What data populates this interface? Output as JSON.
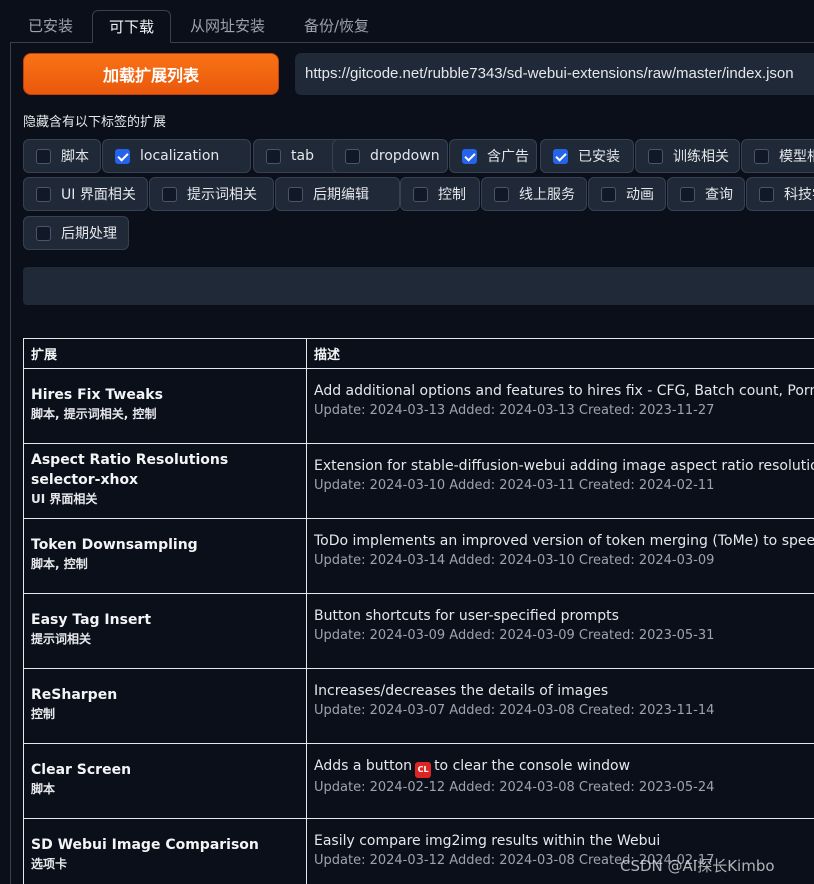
{
  "tabs": [
    {
      "label": "已安装"
    },
    {
      "label": "可下载"
    },
    {
      "label": "从网址安装"
    },
    {
      "label": "备份/恢复"
    }
  ],
  "load_button_label": "加载扩展列表",
  "url_value": "https://gitcode.net/rubble7343/sd-webui-extensions/raw/master/index.json",
  "hide_label": "隐藏含有以下标签的扩展",
  "tags": [
    {
      "label": "脚本",
      "checked": false
    },
    {
      "label": "localization",
      "checked": true
    },
    {
      "label": "tab",
      "checked": false
    },
    {
      "label": "dropdown",
      "checked": false
    },
    {
      "label": "含广告",
      "checked": true
    },
    {
      "label": "已安装",
      "checked": true
    },
    {
      "label": "训练相关",
      "checked": false
    },
    {
      "label": "模型相关",
      "checked": false
    },
    {
      "label": "UI 界面相关",
      "checked": false
    },
    {
      "label": "提示词相关",
      "checked": false
    },
    {
      "label": "后期编辑",
      "checked": false
    },
    {
      "label": "控制",
      "checked": false
    },
    {
      "label": "线上服务",
      "checked": false
    },
    {
      "label": "动画",
      "checked": false
    },
    {
      "label": "查询",
      "checked": false
    },
    {
      "label": "科技学术",
      "checked": false
    },
    {
      "label": "后期处理",
      "checked": false
    }
  ],
  "table": {
    "headers": [
      "扩展",
      "描述"
    ],
    "rows": [
      {
        "name": "Hires Fix Tweaks",
        "tags": "脚本, 提示词相关, 控制",
        "desc": "Add additional options and features to hires fix - CFG, Batch count, Pormpt",
        "dates": "Update: 2024-03-13 Added: 2024-03-13 Created: 2023-11-27"
      },
      {
        "name": "Aspect Ratio Resolutions selector-xhox",
        "tags": "UI 界面相关",
        "desc": "Extension for stable-diffusion-webui adding image aspect ratio resolutions",
        "dates": "Update: 2024-03-10 Added: 2024-03-11 Created: 2024-02-11"
      },
      {
        "name": "Token Downsampling",
        "tags": "脚本, 控制",
        "desc": "ToDo implements an improved version of token merging (ToMe) to speed u",
        "dates": "Update: 2024-03-14 Added: 2024-03-10 Created: 2024-03-09"
      },
      {
        "name": "Easy Tag Insert",
        "tags": "提示词相关",
        "desc": "Button shortcuts for user-specified prompts",
        "dates": "Update: 2024-03-09 Added: 2024-03-09 Created: 2023-05-31"
      },
      {
        "name": "ReSharpen",
        "tags": "控制",
        "desc": "Increases/decreases the details of images",
        "dates": "Update: 2024-03-07 Added: 2024-03-08 Created: 2023-11-14"
      },
      {
        "name": "Clear Screen",
        "tags": "脚本",
        "desc_before": "Adds a button",
        "desc_icon": "CL",
        "desc_after": "to clear the console window",
        "dates": "Update: 2024-02-12 Added: 2024-03-08 Created: 2023-05-24"
      },
      {
        "name": "SD Webui Image Comparison",
        "tags": "选项卡",
        "desc": "Easily compare img2img results within the Webui",
        "dates": "Update: 2024-03-12 Added: 2024-03-08 Created: 2024-02-17"
      }
    ]
  },
  "watermark": "CSDN @AI探长Kimbo"
}
